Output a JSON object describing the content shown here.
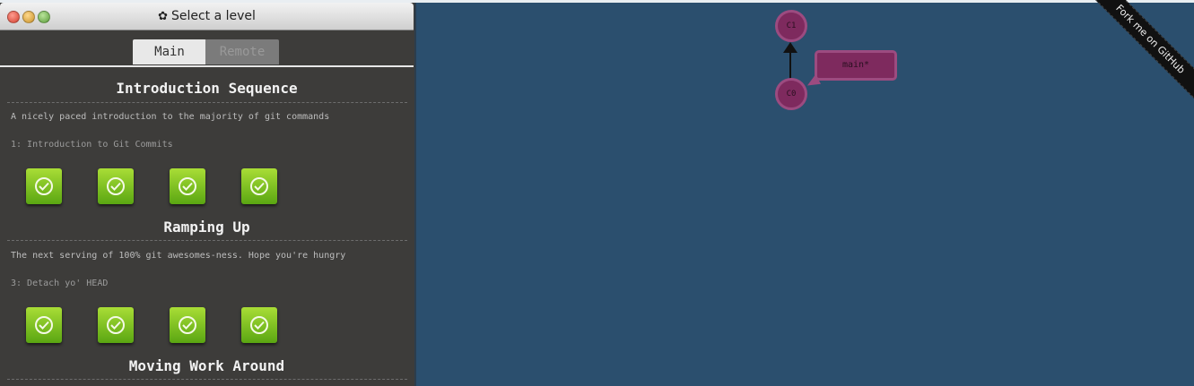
{
  "window": {
    "title": "Select a level",
    "title_icon": "gear-icon"
  },
  "tabs": [
    {
      "label": "Main",
      "active": true
    },
    {
      "label": "Remote",
      "active": false
    }
  ],
  "sequences": [
    {
      "title": "Introduction Sequence",
      "description": "A nicely paced introduction to the majority of git commands",
      "level_description": "1: Introduction to Git Commits",
      "levels": [
        {
          "completed": true,
          "icon": "checkmark-icon"
        },
        {
          "completed": true,
          "icon": "checkmark-icon"
        },
        {
          "completed": true,
          "icon": "checkmark-icon"
        },
        {
          "completed": true,
          "icon": "checkmark-icon"
        }
      ]
    },
    {
      "title": "Ramping Up",
      "description": "The next serving of 100% git awesomes-ness. Hope you're hungry",
      "level_description": "3: Detach yo' HEAD",
      "levels": [
        {
          "completed": true,
          "icon": "checkmark-icon"
        },
        {
          "completed": true,
          "icon": "checkmark-icon"
        },
        {
          "completed": true,
          "icon": "checkmark-icon"
        },
        {
          "completed": true,
          "icon": "checkmark-icon"
        }
      ]
    },
    {
      "title": "Moving Work Around"
    }
  ],
  "graph": {
    "commits": [
      "C0",
      "C1"
    ],
    "branch": "main*"
  },
  "ribbon": "Fork me on GitHub",
  "colors": {
    "canvas": "#2b4f6e",
    "panel": "#3d3c3a",
    "commit_fill": "#7e2a5e",
    "level_green": "#6fb51c"
  }
}
